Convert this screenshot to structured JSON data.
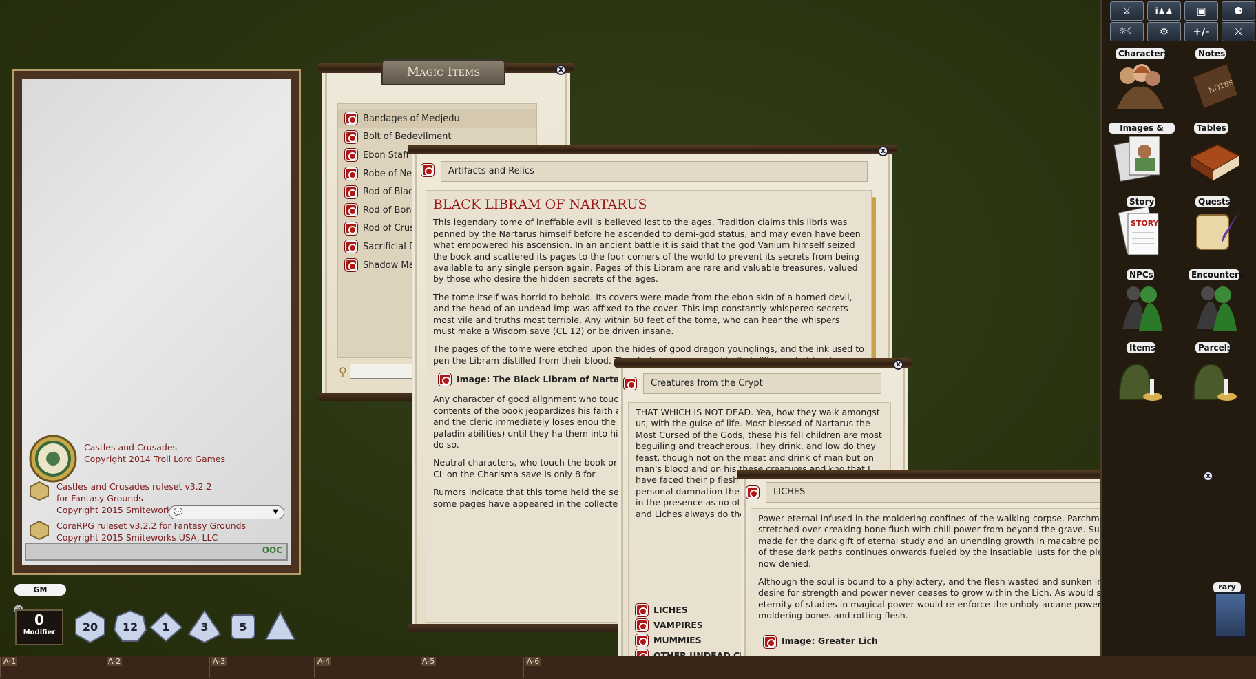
{
  "chat": {
    "entries": [
      {
        "lines": [
          "Castles and Crusades",
          "Copyright 2014 Troll Lord Games"
        ]
      },
      {
        "lines": [
          "Castles and Crusades ruleset v3.2.2",
          "for Fantasy Grounds",
          "Copyright 2015 Smiteworks USA, LLC"
        ]
      },
      {
        "lines": [
          "CoreRPG ruleset v3.2.2 for Fantasy Grounds",
          "Copyright 2015 Smiteworks USA, LLC"
        ]
      }
    ],
    "ooc_label": "OOC"
  },
  "identity": "GM",
  "modifier": {
    "value": "0",
    "label": "Modifier"
  },
  "dice": [
    {
      "name": "d20",
      "face": "20"
    },
    {
      "name": "d12",
      "face": "12"
    },
    {
      "name": "d10",
      "face": "1"
    },
    {
      "name": "d8",
      "face": "3"
    },
    {
      "name": "d6",
      "face": "5"
    },
    {
      "name": "d4",
      "face": ""
    }
  ],
  "hotkeys": [
    "A-1",
    "A-2",
    "A-3",
    "A-4",
    "A-5",
    "A-6"
  ],
  "magic_items": {
    "title": "Magic Items",
    "items": [
      "Bandages of Medjedu",
      "Bolt of Bedevilment",
      "Ebon Staff",
      "Robe of Ne",
      "Rod of Blac",
      "Rod of Bon",
      "Rod of Crus",
      "Sacrificial D",
      "Shadow Ma"
    ]
  },
  "libram": {
    "category": "Artifacts and Relics",
    "title": "BLACK LIBRAM OF NARTARUS",
    "paragraphs": [
      "This legendary tome of ineffable evil is believed lost to the ages. Tradition claims this libris was penned by the Nartarus himself before he ascended to demi-god status, and may even have been what empowered his ascension. In an ancient battle it is said that the god Vanium himself seized the book and scattered its pages to the four corners of the world to prevent its secrets from being available to any single person again. Pages of this Libram are rare and valuable treasures, valued by those who desire the hidden secrets of the ages.",
      "The tome itself was horrid to behold. Its covers were made from the ebon skin of a horned devil, and the head of an undead imp was affixed to the cover. This imp constantly whispered secrets most vile and truths most terrible. Any within 60 feet of the tome, who can hear the whispers must make a Wisdom save (CL 12) or be driven insane.",
      "The pages of the tome were etched upon the hides of good dragon younglings, and the ink used to pen the Libram distilled from their blood. The sh those unprepared to its brilliance, but the h"
    ],
    "image_link": "Image: The Black Libram of Nartarus",
    "paragraphs2": [
      "Any character of good alignment who touch (make a save vs. Constitution CL 12 for 1/2 da contents of the book jeopardizes his faith ar make a Charisma save (CL 12). Failure means taint, and the cleric immediately loses enou the previous level. In addition, they can no lo undead and/or paladin abilities) until they ha them into his service immediately restoring evil in alignment if they do so.",
      "Neutral characters, who touch the book or a Constitution at CL 12 for 1/2 damage). Neutr but the CL on the Charisma save is only 8 for",
      "Rumors indicate that this tome held the sec within would enable one to achieve powers ages, but some pages have appeared in the collected by a vile magician who dwells with"
    ]
  },
  "crypt": {
    "category": "Creatures from the Crypt",
    "text": "THAT WHICH IS NOT DEAD. Yea, how they walk amongst us, with the guise of life. Most blessed of Nartarus the Most Cursed of the Gods, these his fell children are most beguiling and treacherous. They drink, and low do they feast, though not on the meat and drink of man but on man's blood and on his these creatures and kno that I have faced their p flesh and near blasted m own personal damnation the dark secrets found w to safety in the presence as no other, for unlike th the Vampires and Liches always do they yearn. —F",
    "links": [
      "LICHES",
      "VAMPIRES",
      "MUMMIES",
      "OTHER UNDEAD CI"
    ]
  },
  "liches": {
    "category": "LICHES",
    "paragraphs": [
      "Power eternal infused in the moldering confines of the walking corpse. Parchment dry skin stretched over creaking bone flush with chill power from beyond the grave. Such was the choice made for the dark gift of eternal study and an unending growth in macabre power. The traversal of these dark paths continues onwards fueled by the insatiable lusts for the pleasures of the flesh now denied.",
      "Although the soul is bound to a phylactery, and the flesh wasted and sunken in undeath, the desire for strength and power never ceases to grow within the Lich. As would stand to reason, an eternity of studies in magical power would re-enforce the unholy arcane powers infused in its moldering bones and rotting flesh."
    ],
    "image_link": "Image: Greater Lich"
  },
  "sidebar": {
    "toolbar_row1": [
      "⚔",
      "i♟♟",
      "▣",
      "⚈"
    ],
    "toolbar_row2": [
      "☼☾",
      "⚙",
      "+/-",
      "⚔"
    ],
    "library": [
      {
        "label": "Characters",
        "icon": "characters-icon"
      },
      {
        "label": "Notes",
        "icon": "notes-icon"
      },
      {
        "label": "Images & Maps",
        "icon": "images-maps-icon"
      },
      {
        "label": "Tables",
        "icon": "tables-icon"
      },
      {
        "label": "Story",
        "icon": "story-icon"
      },
      {
        "label": "Quests",
        "icon": "quests-icon"
      },
      {
        "label": "NPCs",
        "icon": "npcs-icon"
      },
      {
        "label": "Encounters",
        "icon": "encounters-icon"
      },
      {
        "label": "Items",
        "icon": "items-icon"
      },
      {
        "label": "Parcels",
        "icon": "parcels-icon"
      }
    ],
    "partial_label": "rary"
  },
  "colors": {
    "accent_red": "#b01818",
    "link_red": "#7c2020",
    "parchment": "#efe8d8",
    "wood": "#2e1f12"
  }
}
